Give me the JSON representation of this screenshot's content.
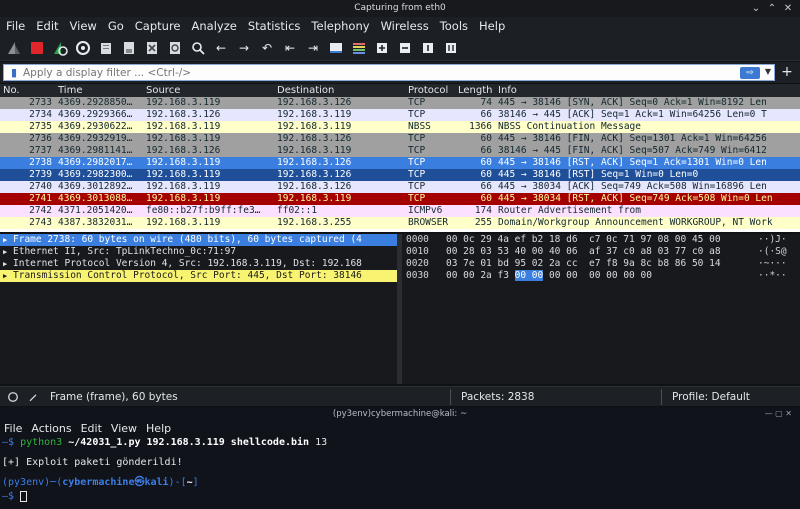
{
  "window": {
    "title": "Capturing from eth0"
  },
  "menu": [
    "File",
    "Edit",
    "View",
    "Go",
    "Capture",
    "Analyze",
    "Statistics",
    "Telephony",
    "Wireless",
    "Tools",
    "Help"
  ],
  "toolbar": {
    "icons": [
      "shark-fin-icon",
      "stop-icon",
      "restart-icon",
      "capture-options-icon",
      "open-file-icon",
      "save-file-icon",
      "close-file-icon",
      "reload-icon",
      "find-icon",
      "go-back-icon",
      "go-forward-icon",
      "go-to-packet-icon",
      "first-packet-icon",
      "last-packet-icon",
      "autoscroll-icon",
      "colorize-icon",
      "zoom-in-icon",
      "zoom-out-icon",
      "normal-size-icon",
      "resize-columns-icon"
    ]
  },
  "filter": {
    "placeholder": "Apply a display filter ... <Ctrl-/>",
    "apply_icon": "arrow-right-icon",
    "add_label": "+"
  },
  "packet_list": {
    "columns": [
      "No.",
      "Time",
      "Source",
      "Destination",
      "Protocol",
      "Length",
      "Info"
    ],
    "rows": [
      {
        "no": "2733",
        "time": "4369.2928850…",
        "src": "192.168.3.119",
        "dst": "192.168.3.126",
        "proto": "TCP",
        "len": "74",
        "info": "445 → 38146 [SYN, ACK] Seq=0 Ack=1 Win=8192 Len",
        "bg": "#a0a0a0",
        "fg": "#12272e"
      },
      {
        "no": "2734",
        "time": "4369.2929366…",
        "src": "192.168.3.126",
        "dst": "192.168.3.119",
        "proto": "TCP",
        "len": "66",
        "info": "38146 → 445 [ACK] Seq=1 Ack=1 Win=64256 Len=0 T",
        "bg": "#e7e6ff",
        "fg": "#12272e"
      },
      {
        "no": "2735",
        "time": "4369.2930622…",
        "src": "192.168.3.119",
        "dst": "192.168.3.119",
        "proto": "NBSS",
        "len": "1366",
        "info": "NBSS Continuation Message",
        "bg": "#ffffc9",
        "fg": "#12272e"
      },
      {
        "no": "2736",
        "time": "4369.2932919…",
        "src": "192.168.3.119",
        "dst": "192.168.3.126",
        "proto": "TCP",
        "len": "60",
        "info": "445 → 38146 [FIN, ACK] Seq=1301 Ack=1 Win=64256",
        "bg": "#a0a0a0",
        "fg": "#12272e"
      },
      {
        "no": "2737",
        "time": "4369.2981141…",
        "src": "192.168.3.126",
        "dst": "192.168.3.119",
        "proto": "TCP",
        "len": "66",
        "info": "38146 → 445 [FIN, ACK] Seq=507 Ack=749 Win=6412",
        "bg": "#a0a0a0",
        "fg": "#12272e"
      },
      {
        "no": "2738",
        "time": "4369.2982017…",
        "src": "192.168.3.119",
        "dst": "192.168.3.126",
        "proto": "TCP",
        "len": "60",
        "info": "445 → 38146 [RST, ACK] Seq=1 Ack=1301 Win=0 Len",
        "bg": "#3a7fe0",
        "fg": "#ffffff"
      },
      {
        "no": "2739",
        "time": "4369.2982300…",
        "src": "192.168.3.119",
        "dst": "192.168.3.126",
        "proto": "TCP",
        "len": "60",
        "info": "445 → 38146 [RST] Seq=1 Win=0 Len=0",
        "bg": "#1f4f99",
        "fg": "#ffffff"
      },
      {
        "no": "2740",
        "time": "4369.3012892…",
        "src": "192.168.3.119",
        "dst": "192.168.3.126",
        "proto": "TCP",
        "len": "66",
        "info": "445 → 38034 [ACK] Seq=749 Ack=508 Win=16896 Len",
        "bg": "#e7e6ff",
        "fg": "#12272e"
      },
      {
        "no": "2741",
        "time": "4369.3013088…",
        "src": "192.168.3.119",
        "dst": "192.168.3.119",
        "proto": "TCP",
        "len": "60",
        "info": "445 → 38034 [RST, ACK] Seq=749 Ack=508 Win=0 Len",
        "bg": "#a40000",
        "fg": "#fffc9c"
      },
      {
        "no": "2742",
        "time": "4371.2051420…",
        "src": "fe80::b27f:b9ff:fe3…",
        "dst": "ff02::1",
        "proto": "ICMPv6",
        "len": "174",
        "info": "Router Advertisement from",
        "bg": "#fce0ff",
        "fg": "#12272e"
      },
      {
        "no": "2743",
        "time": "4387.3832031…",
        "src": "192.168.3.119",
        "dst": "192.168.3.255",
        "proto": "BROWSER",
        "len": "255",
        "info": "Domain/Workgroup Announcement WORKGROUP, NT Work",
        "bg": "#ffffc9",
        "fg": "#12272e"
      }
    ]
  },
  "details": [
    {
      "text": "Frame 2738: 60 bytes on wire (480 bits), 60 bytes captured (4",
      "style": "sel"
    },
    {
      "text": "Ethernet II, Src: TpLinkTechno_0c:71:97",
      "style": ""
    },
    {
      "text": "Internet Protocol Version 4, Src: 192.168.3.119, Dst: 192.168",
      "style": ""
    },
    {
      "text": "Transmission Control Protocol, Src Port: 445, Dst Port: 38146",
      "style": "tcp"
    }
  ],
  "bytes": [
    {
      "off": "0000",
      "hex_pre": "00 0c 29 4a ef b2 18 d6  c7 0c 71 97 08 00 45 00",
      "hex_hl": "",
      "hex_post": "",
      "ascii": "··)J·"
    },
    {
      "off": "0010",
      "hex_pre": "00 28 03 53 40 00 40 06  af 37 c0 a8 03 77 c0 a8",
      "hex_hl": "",
      "hex_post": "",
      "ascii": "·(·S@"
    },
    {
      "off": "0020",
      "hex_pre": "03 7e 01 bd 95 02 2a cc  e7 f8 9a 8c b8 86 50 14",
      "hex_hl": "",
      "hex_post": "",
      "ascii": "·~···"
    },
    {
      "off": "0030",
      "hex_pre": "00 00 2a f3 ",
      "hex_hl": "00 00",
      "hex_post": " 00 00  00 00 00 00",
      "ascii": "··*··"
    }
  ],
  "status": {
    "frame": "Frame (frame), 60 bytes",
    "packets": "Packets: 2838",
    "profile": "Profile: Default"
  },
  "terminal": {
    "title": "(py3env)cybermachine@kali: ~",
    "menu": [
      "File",
      "Actions",
      "Edit",
      "View",
      "Help"
    ],
    "cmd_prefix": "—$ ",
    "cmd_python": "python3",
    "cmd_args": " ~/42031_1.py 192.168.3.119 shellcode.bin",
    "cmd_tail": " 13",
    "output": "[+] Exploit paketi gönderildi!",
    "prompt_env": "(py3env)",
    "prompt_dash": "─(",
    "prompt_user": "cybermachine㉿kali",
    "prompt_path_open": ")-[",
    "prompt_path": "~",
    "prompt_path_close": "]",
    "prompt_line2": "—$ "
  }
}
